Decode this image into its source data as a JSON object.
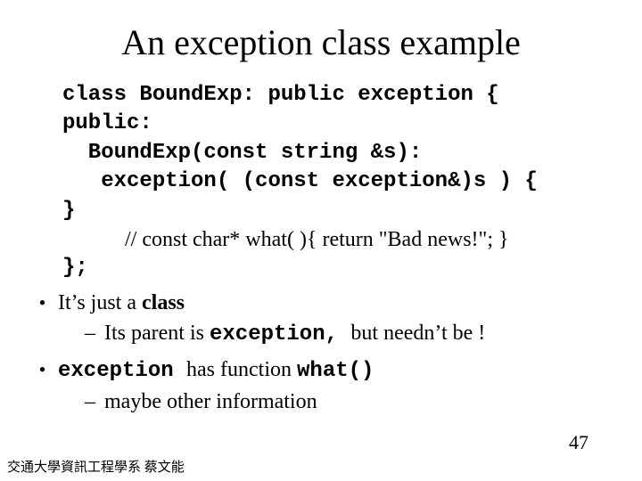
{
  "title": "An exception class example",
  "code": {
    "l1": "class BoundExp: public exception {",
    "l2": "public:",
    "l3": "  BoundExp(const string &s):",
    "l4": "   exception( (const exception&)s ) {",
    "l5": "}",
    "l6": "};"
  },
  "comment_line": "// const char* what( ){ return \"Bad news!\"; }",
  "bullet1": {
    "prefix": "It’s just a ",
    "bold": "class"
  },
  "sub1": {
    "prefix": "Its parent is ",
    "mono": "exception, ",
    "suffix": "but needn’t be !"
  },
  "bullet2": {
    "mono1": "exception ",
    "mid": "has function ",
    "mono2": "what()"
  },
  "sub2": "maybe other information",
  "footer": "交通大學資訊工程學系 蔡文能",
  "page": "47"
}
